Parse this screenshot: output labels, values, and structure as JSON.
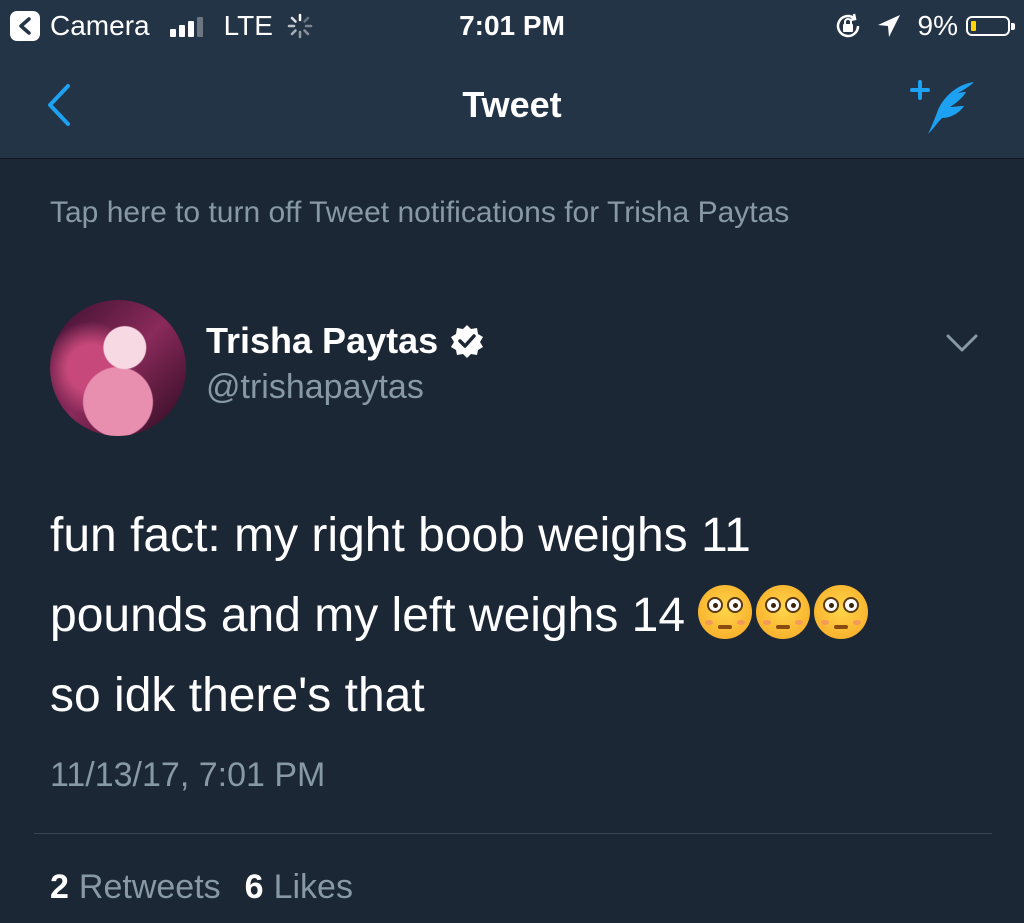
{
  "status_bar": {
    "back_app": "Camera",
    "carrier": "LTE",
    "time": "7:01 PM",
    "battery": "9%",
    "battery_level": 0.09
  },
  "nav": {
    "title": "Tweet"
  },
  "notification_banner": "Tap here to turn off Tweet notifications for Trisha Paytas",
  "author": {
    "name": "Trisha Paytas",
    "handle": "@trishapaytas",
    "verified": true
  },
  "tweet": {
    "line1": "fun fact: my right boob weighs 11",
    "line2": "pounds and my left weighs 14",
    "line3": "so idk there's that",
    "emoji": "flushed-face",
    "emoji_count": 3,
    "timestamp": "11/13/17, 7:01 PM"
  },
  "stats": {
    "retweets_count": "2",
    "retweets_label": "Retweets",
    "likes_count": "6",
    "likes_label": "Likes"
  },
  "colors": {
    "background": "#1b2735",
    "header": "#243447",
    "accent": "#1da1f2",
    "secondary_text": "#8899a6"
  }
}
